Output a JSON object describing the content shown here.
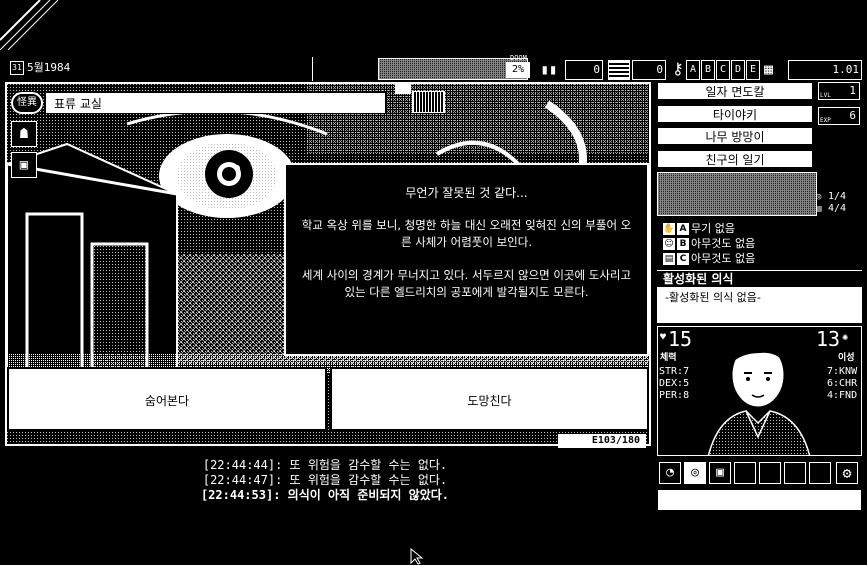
{
  "top_bar": {
    "date": "5월1984",
    "doom_label": "DOOM",
    "doom_value": "2%",
    "counter_1": "0",
    "counter_2": "0",
    "letters": [
      "A",
      "B",
      "C",
      "D",
      "E"
    ],
    "version": "1.01"
  },
  "location": {
    "badge": "怪異",
    "title": "표류 교실"
  },
  "dialogue": {
    "title": "무언가 잘못된 것 같다...",
    "para1": "학교 옥상 위를 보니, 청명한 하늘 대신 오래전 잊혀진 신의 부풀어 오른 사체가 어렴풋이 보인다.",
    "para2": "세계 사이의 경계가 무너지고 있다. 서두르지 않으면 이곳에 도사리고 있는 다른 엘드리치의 공포에게 발각될지도 모른다."
  },
  "choices": [
    {
      "label": "숨어본다"
    },
    {
      "label": "도망친다"
    }
  ],
  "event_id": "E103/180",
  "log": [
    "[22:44:44]: 또 위험을 감수할 수는 없다.",
    "[22:44:47]: 또 위험을 감수할 수는 없다.",
    "[22:44:53]: 의식이 아직 준비되지 않았다."
  ],
  "inventory": {
    "items": [
      "일자 면도칼",
      "타이야키",
      "나무 방망이",
      "친구의 일기"
    ],
    "lvl_label": "LVL",
    "lvl_value": "1",
    "exp_label": "EXP",
    "exp_value": "6",
    "counts": [
      "1/4",
      "4/4"
    ]
  },
  "equipment": [
    {
      "slot": "A",
      "label": "무기 없음"
    },
    {
      "slot": "B",
      "label": "아무것도 없음"
    },
    {
      "slot": "C",
      "label": "아무것도 없음"
    }
  ],
  "rituals": {
    "header": "활성화된 의식",
    "empty": "-활성화된 의식 없음-"
  },
  "character": {
    "stamina": "15",
    "stamina_label": "체력",
    "reason": "13",
    "reason_label": "이성",
    "str": "STR:7",
    "dex": "DEX:5",
    "per": "PER:8",
    "knw": "7:KNW",
    "chr": "6:CHR",
    "fnd": "4:FND"
  },
  "colors": {
    "bg": "#000000",
    "fg": "#ffffff"
  }
}
